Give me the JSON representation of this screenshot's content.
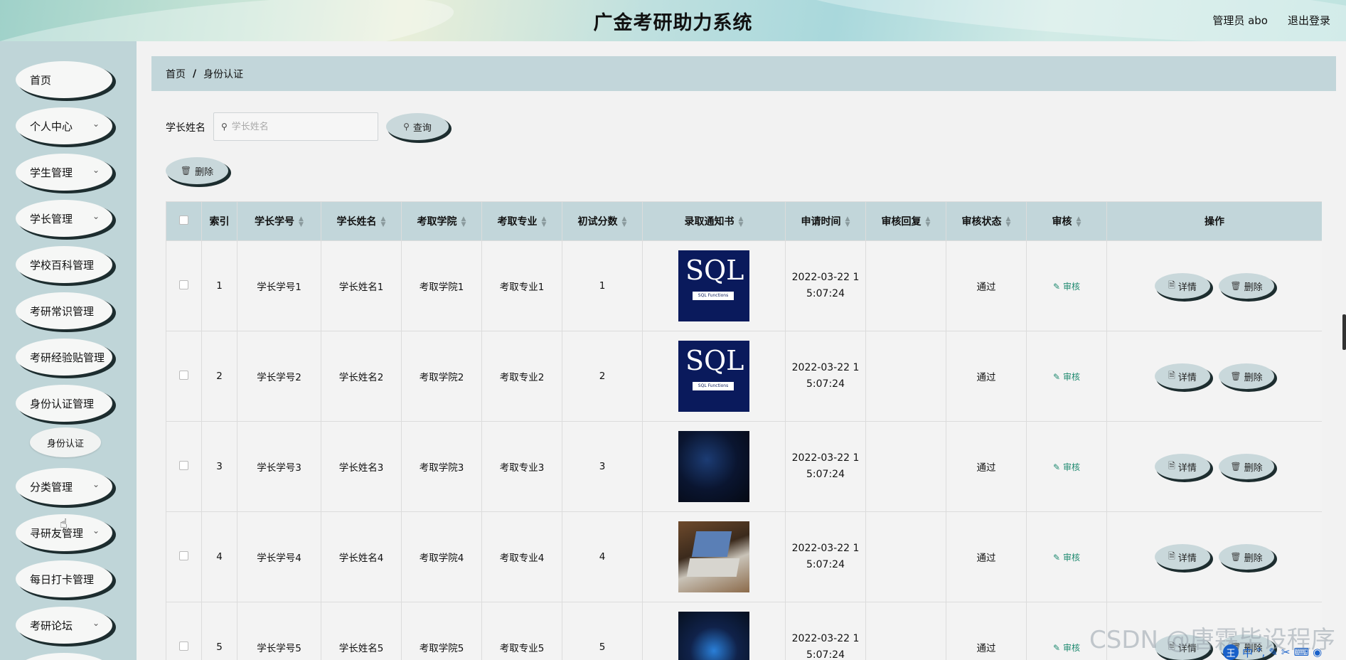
{
  "header": {
    "title": "广金考研助力系统",
    "user": "管理员 abo",
    "logout": "退出登录"
  },
  "sidebar": {
    "items": [
      {
        "label": "首页",
        "has_children": false
      },
      {
        "label": "个人中心",
        "has_children": true
      },
      {
        "label": "学生管理",
        "has_children": true
      },
      {
        "label": "学长管理",
        "has_children": true
      },
      {
        "label": "学校百科管理",
        "has_children": false
      },
      {
        "label": "考研常识管理",
        "has_children": false
      },
      {
        "label": "考研经验贴管理",
        "has_children": false
      },
      {
        "label": "身份认证管理",
        "has_children": false
      },
      {
        "label": "分类管理",
        "has_children": true
      },
      {
        "label": "寻研友管理",
        "has_children": true
      },
      {
        "label": "每日打卡管理",
        "has_children": false
      },
      {
        "label": "考研论坛",
        "has_children": true
      }
    ],
    "sub_item": "身份认证"
  },
  "breadcrumb": {
    "home": "首页",
    "sep": "/",
    "current": "身份认证"
  },
  "search": {
    "label": "学长姓名",
    "placeholder": "学长姓名",
    "button": "查询"
  },
  "toolbar": {
    "delete": "删除"
  },
  "table": {
    "headers": [
      "索引",
      "学长学号",
      "学长姓名",
      "考取学院",
      "考取专业",
      "初试分数",
      "录取通知书",
      "申请时间",
      "审核回复",
      "审核状态",
      "审核",
      "操作"
    ],
    "rows": [
      {
        "index": "1",
        "id": "学长学号1",
        "name": "学长姓名1",
        "college": "考取学院1",
        "major": "考取专业1",
        "score": "1",
        "thumb": "sql",
        "thumb_text": "SQL",
        "thumb_sub": "SQL Functions",
        "time_line1": "2022-03-22 1",
        "time_line2": "5:07:24",
        "reply": "",
        "status": "通过",
        "audit": "审核",
        "detail": "详情",
        "del": "删除"
      },
      {
        "index": "2",
        "id": "学长学号2",
        "name": "学长姓名2",
        "college": "考取学院2",
        "major": "考取专业2",
        "score": "2",
        "thumb": "sql",
        "thumb_text": "SQL",
        "thumb_sub": "SQL Functions",
        "time_line1": "2022-03-22 1",
        "time_line2": "5:07:24",
        "reply": "",
        "status": "通过",
        "audit": "审核",
        "detail": "详情",
        "del": "删除"
      },
      {
        "index": "3",
        "id": "学长学号3",
        "name": "学长姓名3",
        "college": "考取学院3",
        "major": "考取专业3",
        "score": "3",
        "thumb": "matrix",
        "time_line1": "2022-03-22 1",
        "time_line2": "5:07:24",
        "reply": "",
        "status": "通过",
        "audit": "审核",
        "detail": "详情",
        "del": "删除"
      },
      {
        "index": "4",
        "id": "学长学号4",
        "name": "学长姓名4",
        "college": "考取学院4",
        "major": "考取专业4",
        "score": "4",
        "thumb": "laptop",
        "time_line1": "2022-03-22 1",
        "time_line2": "5:07:24",
        "reply": "",
        "status": "通过",
        "audit": "审核",
        "detail": "详情",
        "del": "删除"
      },
      {
        "index": "5",
        "id": "学长学号5",
        "name": "学长姓名5",
        "college": "考取学院5",
        "major": "考取专业5",
        "score": "5",
        "thumb": "hero",
        "time_line1": "2022-03-22 1",
        "time_line2": "5:07:24",
        "reply": "",
        "status": "通过",
        "audit": "审核",
        "detail": "详情",
        "del": "删除"
      }
    ]
  },
  "watermark": "CSDN @唐霖毕设程序",
  "ime": {
    "logo": "王",
    "lang": "中"
  }
}
